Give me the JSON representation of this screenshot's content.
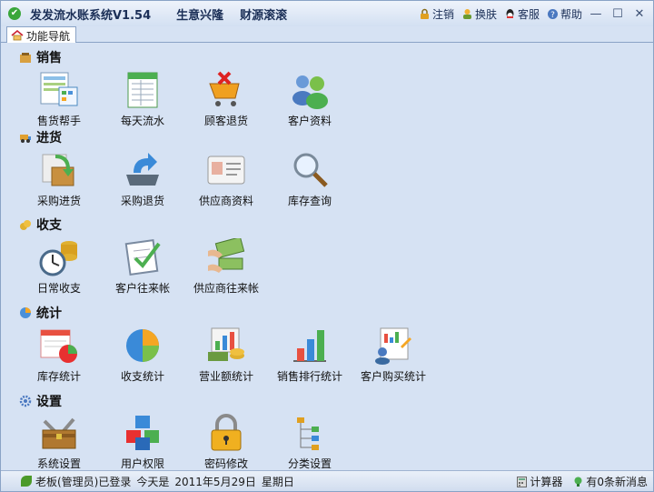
{
  "window": {
    "title": "发发流水账系统V1.54",
    "slogans": [
      "生意兴隆",
      "财源滚滚"
    ],
    "actions": [
      {
        "label": "注销",
        "icon": "lock-icon"
      },
      {
        "label": "换肤",
        "icon": "skin-icon"
      },
      {
        "label": "客服",
        "icon": "qq-icon"
      },
      {
        "label": "帮助",
        "icon": "help-icon"
      }
    ],
    "controls": {
      "minimize": "—",
      "maximize": "☐",
      "close": "✕"
    }
  },
  "tab": {
    "label": "功能导航",
    "icon": "house-icon"
  },
  "sections": [
    {
      "title": "销售",
      "icon": "sales-icon",
      "items": [
        {
          "label": "售货帮手",
          "icon": "sales-helper-icon"
        },
        {
          "label": "每天流水",
          "icon": "daily-ledger-icon"
        },
        {
          "label": "顾客退货",
          "icon": "customer-return-icon"
        },
        {
          "label": "客户资料",
          "icon": "customer-info-icon"
        }
      ]
    },
    {
      "title": "进货",
      "icon": "purchase-icon",
      "items": [
        {
          "label": "采购进货",
          "icon": "purchase-in-icon"
        },
        {
          "label": "采购退货",
          "icon": "purchase-return-icon"
        },
        {
          "label": "供应商资料",
          "icon": "supplier-card-icon"
        },
        {
          "label": "库存查询",
          "icon": "magnifier-icon"
        }
      ]
    },
    {
      "title": "收支",
      "icon": "finance-icon",
      "items": [
        {
          "label": "日常收支",
          "icon": "clock-coins-icon"
        },
        {
          "label": "客户往来帐",
          "icon": "checklist-icon"
        },
        {
          "label": "供应商往来帐",
          "icon": "cash-hands-icon"
        }
      ]
    },
    {
      "title": "统计",
      "icon": "stats-icon",
      "items": [
        {
          "label": "库存统计",
          "icon": "inventory-chart-icon"
        },
        {
          "label": "收支统计",
          "icon": "pie-chart-icon"
        },
        {
          "label": "营业额统计",
          "icon": "turnover-chart-icon"
        },
        {
          "label": "销售排行统计",
          "icon": "bar-chart-icon"
        },
        {
          "label": "客户购买统计",
          "icon": "customer-report-icon"
        }
      ]
    },
    {
      "title": "设置",
      "icon": "settings-icon",
      "items": [
        {
          "label": "系统设置",
          "icon": "toolbox-icon"
        },
        {
          "label": "用户权限",
          "icon": "cubes-icon"
        },
        {
          "label": "密码修改",
          "icon": "padlock-icon"
        },
        {
          "label": "分类设置",
          "icon": "tree-icon"
        }
      ]
    }
  ],
  "status": {
    "user": "老板(管理员)已登录",
    "today_label": "今天是",
    "date": "2011年5月29日",
    "weekday": "星期日",
    "calculator": "计算器",
    "messages": "有0条新消息"
  },
  "colors": {
    "accent": "#1b2f57",
    "background": "#d6e2f3"
  }
}
